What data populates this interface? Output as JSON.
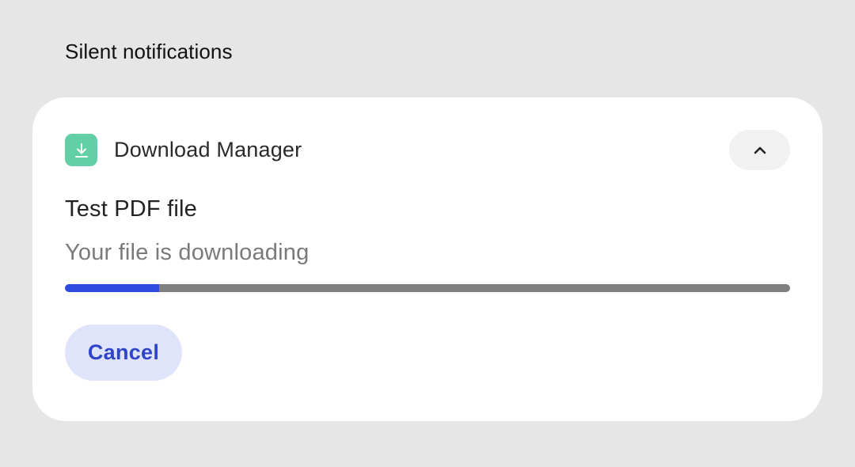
{
  "section": {
    "title": "Silent notifications"
  },
  "notification": {
    "app_name": "Download Manager",
    "app_icon": "download-icon",
    "app_icon_color": "#62cfa6",
    "expand_icon": "chevron-up-icon",
    "title": "Test PDF file",
    "text": "Your file is downloading",
    "progress_fraction": 0.13,
    "progress_color": "#2f4be0",
    "progress_track_color": "#808080",
    "actions": {
      "cancel_label": "Cancel"
    }
  }
}
